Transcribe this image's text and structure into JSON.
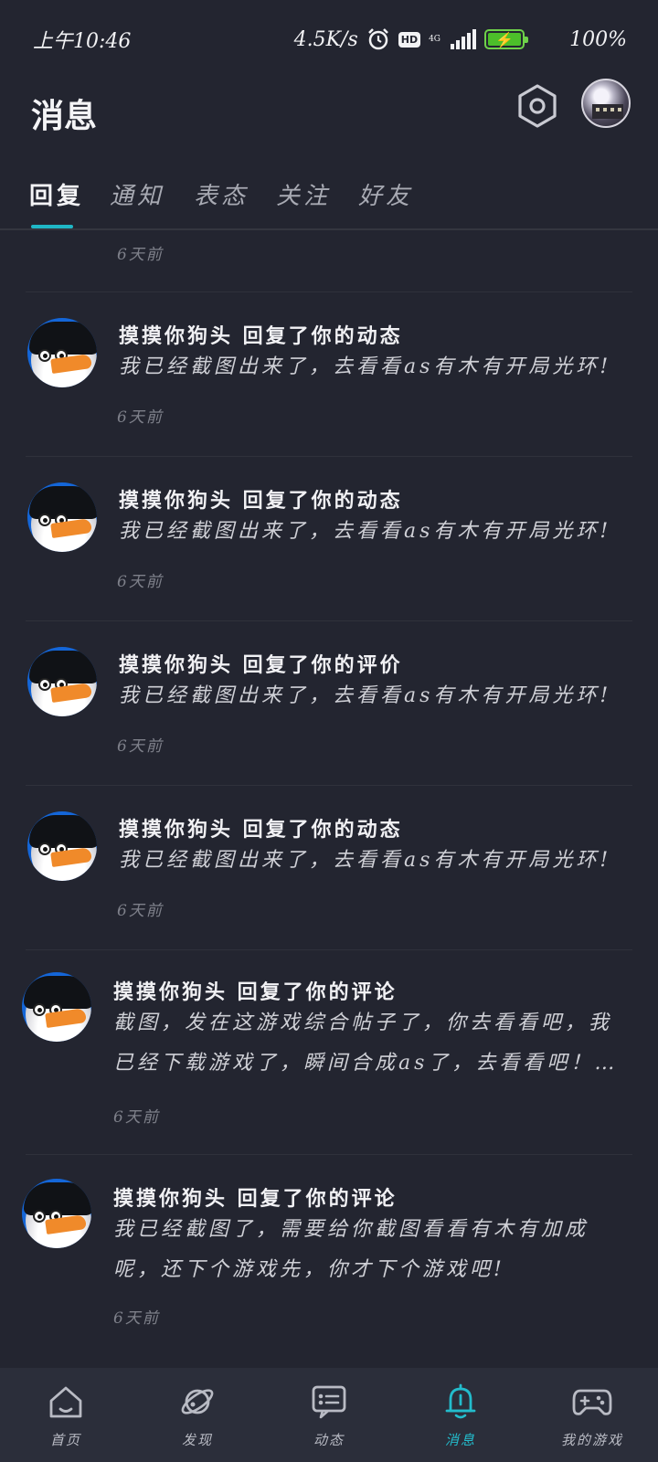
{
  "status_bar": {
    "time": "上午10:46",
    "network_speed": "4.5K/s",
    "hd_badge": "HD",
    "network_type": "4G",
    "battery_percent": "100%",
    "icons": [
      "alarm-icon",
      "hd-icon",
      "signal-icon",
      "battery-icon"
    ]
  },
  "header": {
    "title": "消息",
    "settings_icon": "settings-hexagon-icon",
    "avatar_icon": "user-avatar"
  },
  "tabs": [
    {
      "label": "回复",
      "active": true
    },
    {
      "label": "通知",
      "active": false
    },
    {
      "label": "表态",
      "active": false
    },
    {
      "label": "关注",
      "active": false
    },
    {
      "label": "好友",
      "active": false
    }
  ],
  "accent_color": "#1fb7c6",
  "messages": [
    {
      "time": "6天前"
    },
    {
      "title": "摸摸你狗头 回复了你的动态",
      "content": "我已经截图出来了，去看看as有木有开局光环!",
      "time": "6天前"
    },
    {
      "title": "摸摸你狗头 回复了你的动态",
      "content": "我已经截图出来了，去看看as有木有开局光环!",
      "time": "6天前"
    },
    {
      "title": "摸摸你狗头 回复了你的评价",
      "content": "我已经截图出来了，去看看as有木有开局光环!",
      "time": "6天前"
    },
    {
      "title": "摸摸你狗头 回复了你的动态",
      "content": "我已经截图出来了，去看看as有木有开局光环!",
      "time": "6天前"
    },
    {
      "title": "摸摸你狗头 回复了你的评论",
      "content": "截图，发在这游戏综合帖子了，你去看看吧，我已经下载游戏了，瞬间合成as了，去看看吧！…",
      "time": "6天前"
    },
    {
      "title": "摸摸你狗头 回复了你的评论",
      "content": "我已经截图了，需要给你截图看看有木有加成呢，还下个游戏先，你才下个游戏吧!",
      "time": "6天前"
    }
  ],
  "bottom_nav": [
    {
      "label": "首页",
      "icon": "home-icon",
      "active": false
    },
    {
      "label": "发现",
      "icon": "planet-icon",
      "active": false
    },
    {
      "label": "动态",
      "icon": "chat-card-icon",
      "active": false
    },
    {
      "label": "消息",
      "icon": "bell-icon",
      "active": true
    },
    {
      "label": "我的游戏",
      "icon": "gamepad-icon",
      "active": false
    }
  ]
}
